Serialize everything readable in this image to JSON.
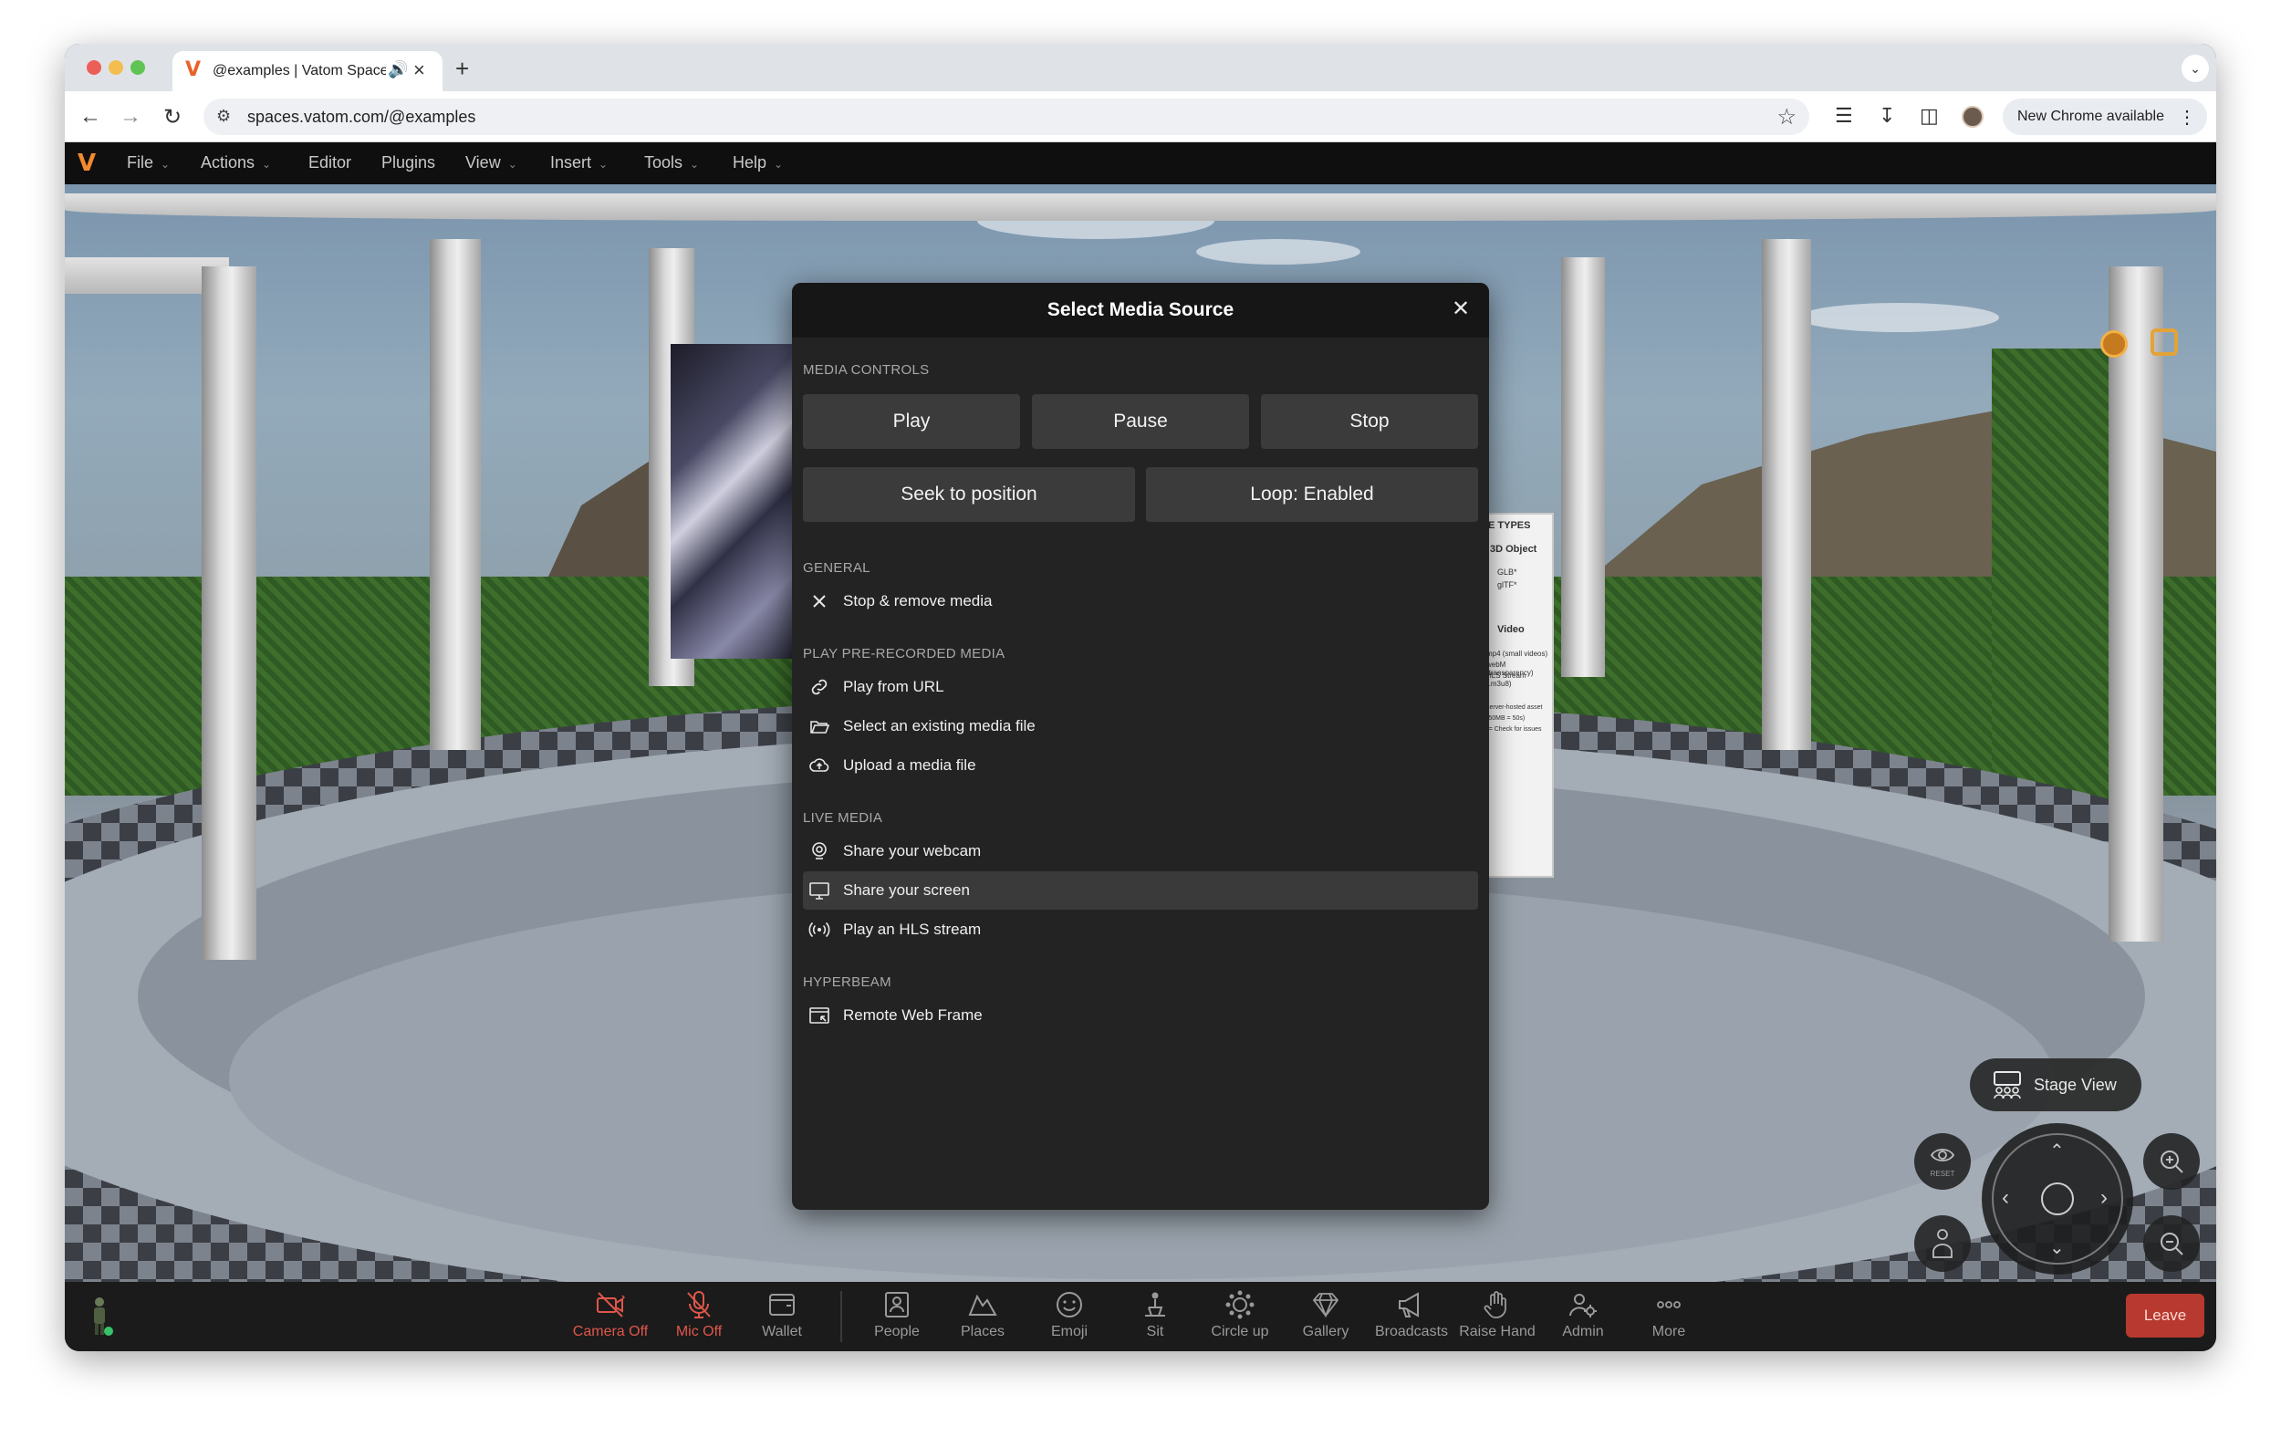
{
  "browser": {
    "tab_title": "@examples | Vatom Spaces",
    "url": "spaces.vatom.com/@examples",
    "update_label": "New Chrome available"
  },
  "menubar": {
    "items": [
      "File",
      "Actions",
      "Editor",
      "Plugins",
      "View",
      "Insert",
      "Tools",
      "Help"
    ]
  },
  "scene": {
    "sign_types": "E TYPES",
    "sign_3d": "3D Object",
    "sign_glb": "GLB*",
    "sign_gltf": "glTF*",
    "sign_video": "Video",
    "sign_video_1": "mp4 (small videos)",
    "sign_video_2": "webM (transparency)",
    "sign_video_3": "HLS Stream (.m3u8)",
    "sign_note_1": "server-hosted asset",
    "sign_note_2": "(50MB = 50s)",
    "sign_note_3": "*= Check for issues"
  },
  "modal": {
    "title": "Select Media Source",
    "sections": {
      "media_controls": "MEDIA CONTROLS",
      "general": "GENERAL",
      "prerecorded": "PLAY PRE-RECORDED MEDIA",
      "live": "LIVE MEDIA",
      "hyperbeam": "HYPERBEAM"
    },
    "buttons": {
      "play": "Play",
      "pause": "Pause",
      "stop": "Stop",
      "seek": "Seek to position",
      "loop": "Loop: Enabled"
    },
    "rows": {
      "stop_remove": "Stop & remove media",
      "play_url": "Play from URL",
      "select_existing": "Select an existing media file",
      "upload": "Upload a media file",
      "webcam": "Share your webcam",
      "screen": "Share your screen",
      "hls": "Play an HLS stream",
      "remote_frame": "Remote Web Frame"
    }
  },
  "controls": {
    "stage_view": "Stage View",
    "reset_label": "RESET"
  },
  "bottombar": {
    "camera": "Camera Off",
    "mic": "Mic Off",
    "wallet": "Wallet",
    "people": "People",
    "places": "Places",
    "emoji": "Emoji",
    "sit": "Sit",
    "circle_up": "Circle up",
    "gallery": "Gallery",
    "broadcasts": "Broadcasts",
    "raise_hand": "Raise Hand",
    "admin": "Admin",
    "more": "More",
    "leave": "Leave"
  },
  "colors": {
    "accent_orange": "#f28a2e",
    "danger_red": "#e0574a",
    "leave_red": "#b7392f",
    "modal_bg": "#232323"
  }
}
